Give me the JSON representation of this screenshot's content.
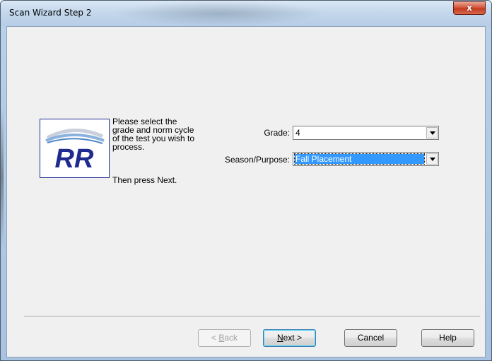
{
  "window": {
    "title": "Scan Wizard Step 2",
    "close_glyph": "x"
  },
  "logo": {
    "text": "RR"
  },
  "instructions": {
    "line1": "Please select the",
    "line2": "grade and norm cycle",
    "line3": "of the test you wish to",
    "line4": "process.",
    "then": "Then press Next."
  },
  "form": {
    "grade_label": "Grade:",
    "grade_value": "4",
    "season_label": "Season/Purpose:",
    "season_value": "Fall Placement"
  },
  "buttons": {
    "back_prefix": "< ",
    "back_mnemonic": "B",
    "back_rest": "ack",
    "next_mnemonic": "N",
    "next_rest": "ext >",
    "cancel": "Cancel",
    "help": "Help"
  },
  "colors": {
    "selection": "#3399ff",
    "logo_blue": "#1f2b8f",
    "close_red": "#c23b1f"
  }
}
